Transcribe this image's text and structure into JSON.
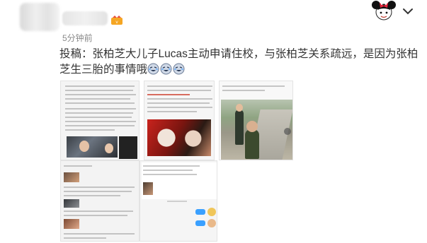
{
  "post": {
    "time": "5分钟前",
    "text": "投稿：张柏芝大儿子Lucas主动申请住校，与张柏芝关系疏远，是因为张柏芝生三胎的事情哦",
    "emoji_icons": [
      "laughing-emoji-icon",
      "laughing-emoji-icon",
      "laughing-emoji-icon"
    ]
  },
  "header": {
    "right_avatar_icon": "mickey-avatar-icon",
    "menu_icon": "chevron-down-icon"
  },
  "images": [
    {
      "label": "screenshot-article-1"
    },
    {
      "label": "screenshot-article-2"
    },
    {
      "label": "photo-boys-on-road"
    },
    {
      "label": "screenshot-article-3"
    },
    {
      "label": "screenshot-chat"
    }
  ],
  "colors": {
    "text": "#333333",
    "time": "#8a8a8a",
    "chat_bubble": "#3aa0ff"
  }
}
